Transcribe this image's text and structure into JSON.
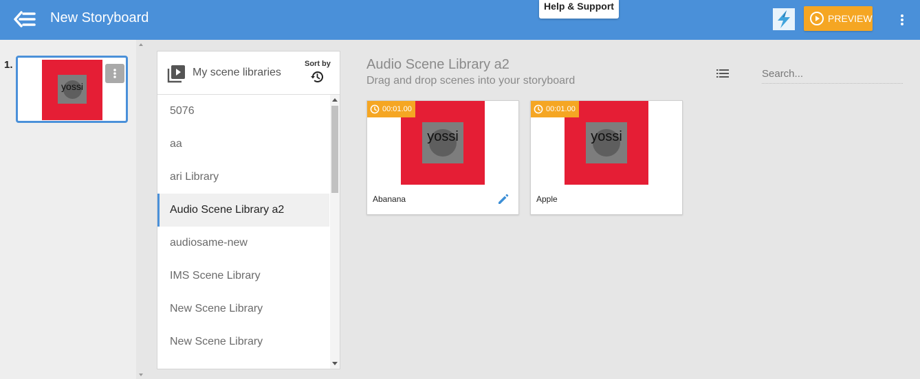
{
  "header": {
    "title": "New Storyboard",
    "help_label": "Help & Support",
    "preview_label": "PREVIEW",
    "brand_color": "#4a90d9",
    "accent_color": "#f5a623"
  },
  "storyboard": {
    "scenes": [
      {
        "index": "1.",
        "thumb_text": "yossi"
      }
    ]
  },
  "libraries": {
    "title": "My scene libraries",
    "sort_label": "Sort by",
    "items": [
      {
        "label": "5076"
      },
      {
        "label": "aa"
      },
      {
        "label": "ari Library"
      },
      {
        "label": "Audio Scene Library a2",
        "active": true
      },
      {
        "label": "audiosame-new"
      },
      {
        "label": "IMS Scene Library"
      },
      {
        "label": "New Scene Library"
      },
      {
        "label": "New Scene Library"
      }
    ]
  },
  "main": {
    "title": "Audio Scene Library a2",
    "subtitle": "Drag and drop scenes into your storyboard",
    "search_placeholder": "Search...",
    "cards": [
      {
        "name": "Abanana",
        "duration": "00:01.00",
        "thumb_text": "yossi",
        "editable": true
      },
      {
        "name": "Apple",
        "duration": "00:01.00",
        "thumb_text": "yossi",
        "editable": false
      }
    ]
  }
}
